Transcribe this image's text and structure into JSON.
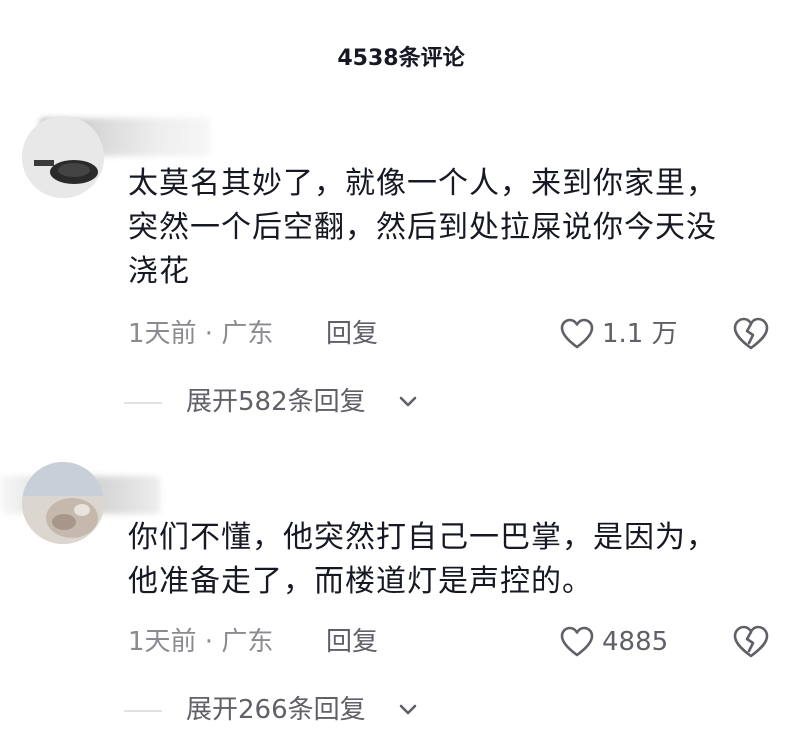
{
  "header": {
    "title": "4538条评论"
  },
  "comments": [
    {
      "text_lines": [
        "太莫名其妙了，就像一个人，来到你家里，",
        "突然一个后空翻，然后到处拉屎说你今天没",
        "浇花"
      ],
      "time_location": "1天前 · 广东",
      "reply_label": "回复",
      "likes": "1.1 万",
      "expand_replies": "展开582条回复"
    },
    {
      "text_lines": [
        "你们不懂，他突然打自己一巴掌，是因为，",
        "他准备走了，而楼道灯是声控的。"
      ],
      "time_location": "1天前 · 广东",
      "reply_label": "回复",
      "likes": "4885",
      "expand_replies": "展开266条回复"
    }
  ],
  "icons": {
    "like": "heart-outline-icon",
    "dislike": "broken-heart-icon",
    "expand": "chevron-down-icon"
  },
  "colors": {
    "text_primary": "#161823",
    "text_secondary": "#8a8b91",
    "divider": "#e2e2e4"
  }
}
